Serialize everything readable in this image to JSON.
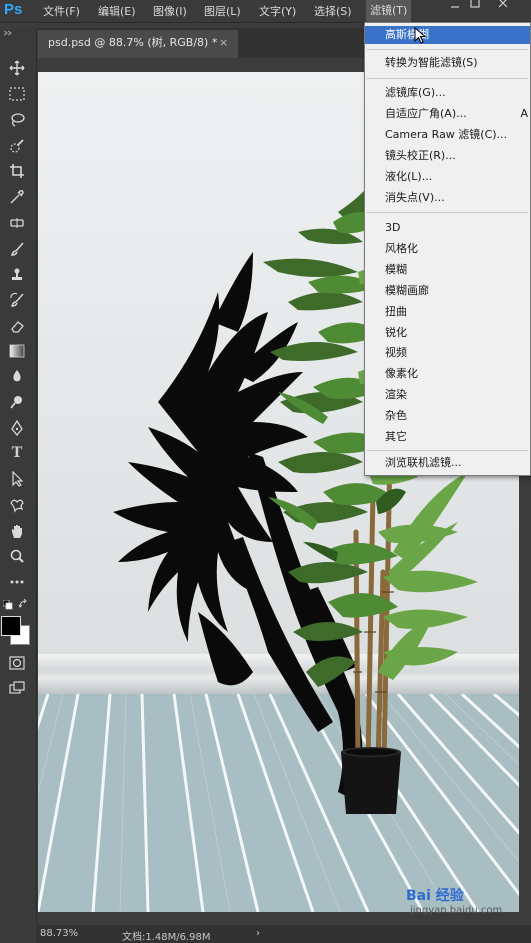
{
  "app": {
    "logo": "Ps"
  },
  "menubar": {
    "items": [
      "文件(F)",
      "编辑(E)",
      "图像(I)",
      "图层(L)",
      "文字(Y)",
      "选择(S)",
      "滤镜(T)"
    ]
  },
  "tab": {
    "title": "psd.psd @ 88.7% (树, RGB/8) *",
    "close": "×"
  },
  "status": {
    "zoom": "88.73%",
    "doc": "文档:1.48M/6.98M",
    "arrow": "›"
  },
  "filter_menu": {
    "last_filter": "高斯模糊",
    "convert_smart": "转换为智能滤镜(S)",
    "group1": [
      "滤镜库(G)...",
      "自适应广角(A)...",
      "Camera Raw 滤镜(C)...",
      "镜头校正(R)...",
      "液化(L)...",
      "消失点(V)..."
    ],
    "group1_shortcut": "A",
    "group2": [
      "3D",
      "风格化",
      "模糊",
      "模糊画廊",
      "扭曲",
      "锐化",
      "视频",
      "像素化",
      "渲染",
      "杂色",
      "其它"
    ],
    "browse": "浏览联机滤镜..."
  },
  "watermark": {
    "brand": "Bai 经验",
    "url": "jingyan.baidu.com"
  },
  "colors": {
    "menu_highlight": "#3a72c9",
    "ps_blue": "#31a8ff",
    "background": "#3c3c3c"
  }
}
